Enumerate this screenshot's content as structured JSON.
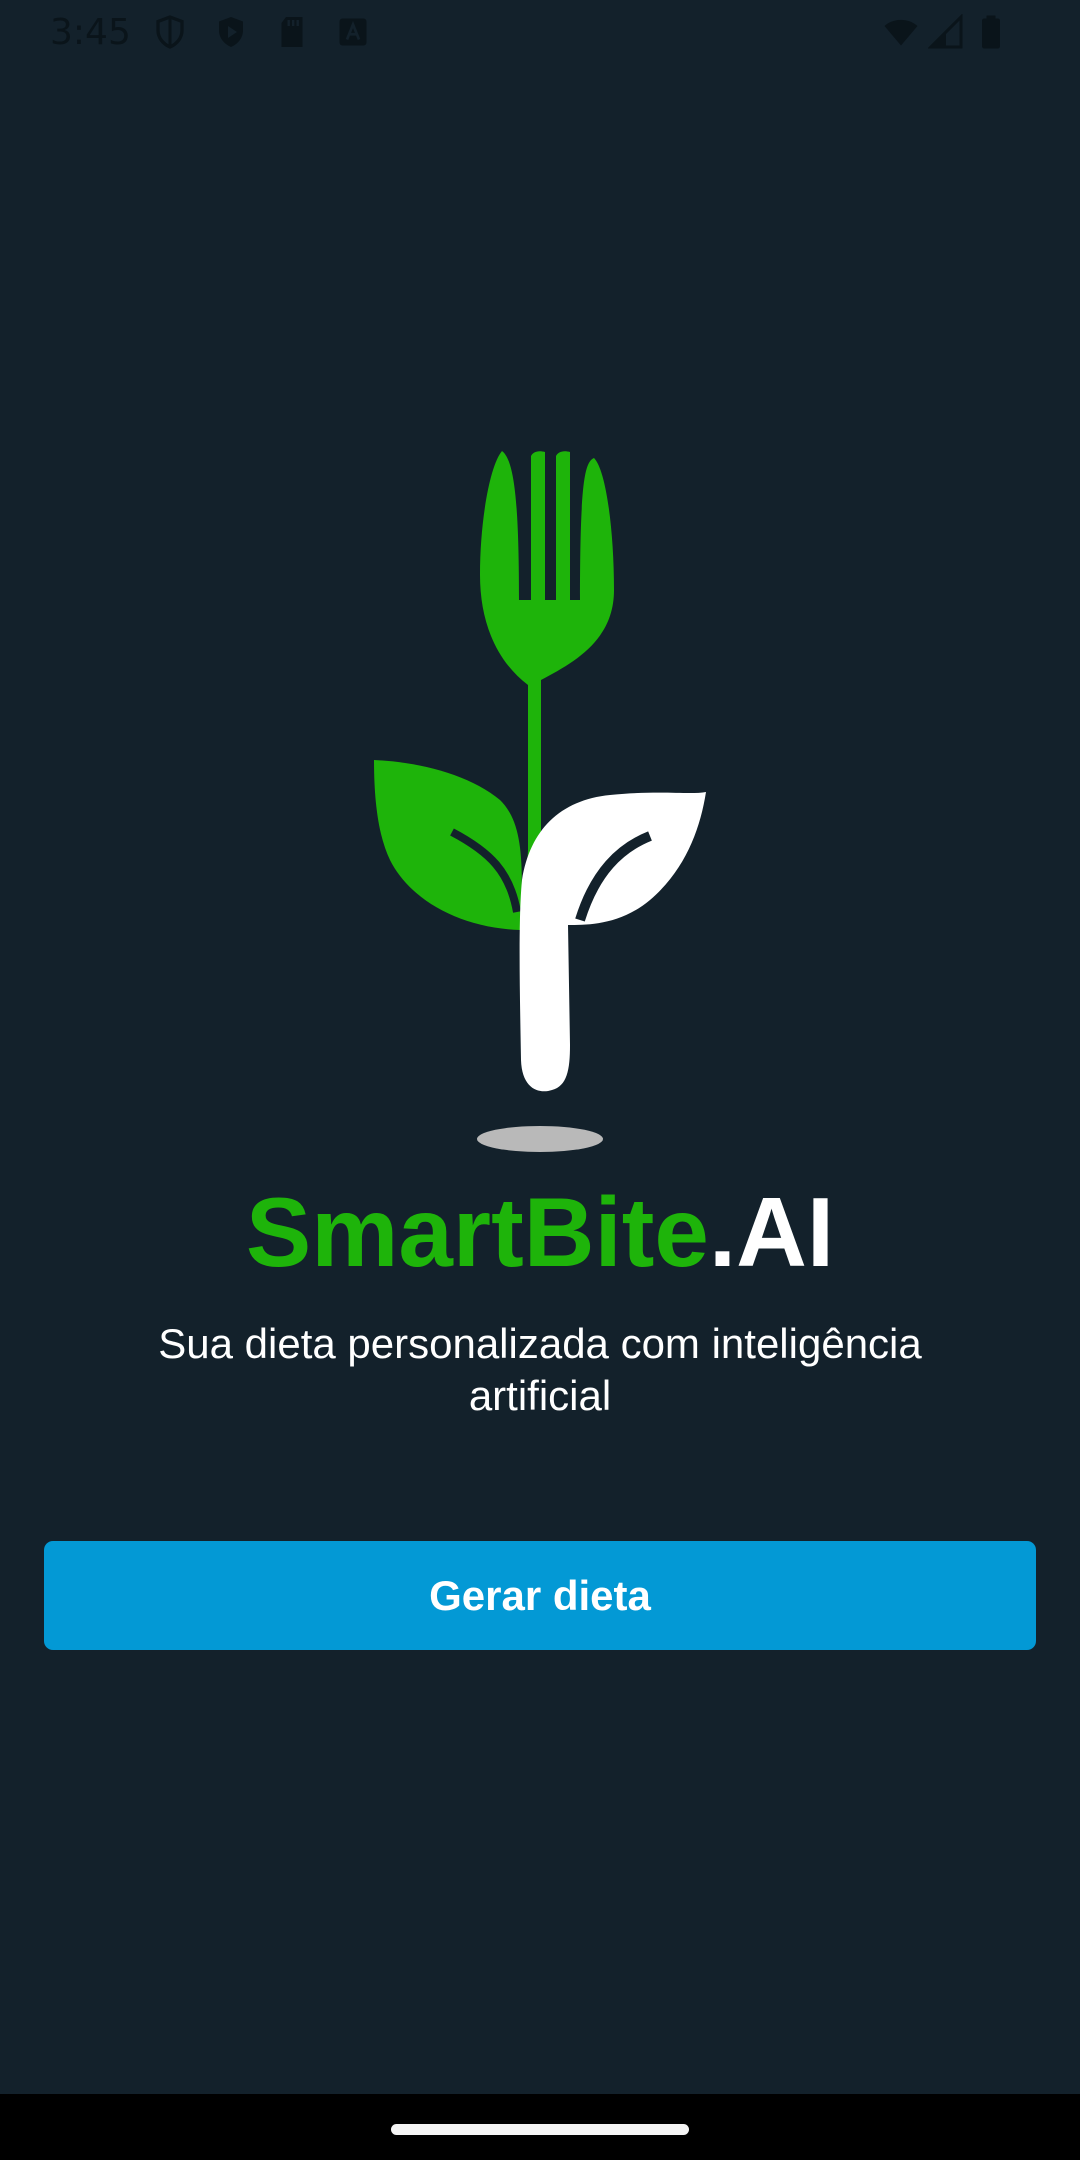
{
  "status_bar": {
    "time": "3:45",
    "left_icons": [
      "shield-icon",
      "play-protect-icon",
      "sd-card-icon",
      "a-badge-icon"
    ],
    "right_icons": [
      "wifi-icon",
      "signal-icon",
      "battery-icon"
    ]
  },
  "brand": {
    "name_primary": "SmartBite",
    "name_suffix": ".AI",
    "primary_color": "#1eb40a",
    "suffix_color": "#ffffff"
  },
  "tagline": "Sua dieta personalizada com inteligência artificial",
  "cta": {
    "label": "Gerar dieta",
    "color": "#0399d5"
  },
  "colors": {
    "background": "#13212b",
    "fork_green": "#1eb40a",
    "leaf_white": "#ffffff"
  }
}
